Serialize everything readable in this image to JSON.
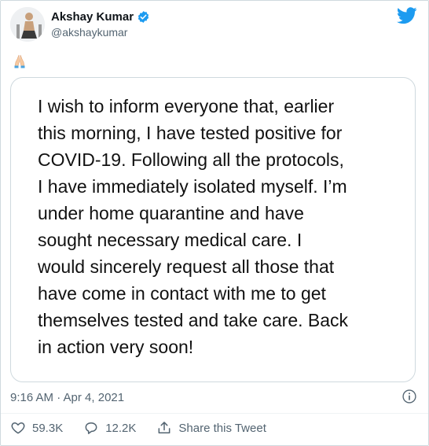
{
  "author": {
    "name": "Akshay Kumar",
    "handle": "@akshaykumar"
  },
  "tweet": {
    "emoji": "🙏",
    "image_text": "I wish to inform everyone that, earlier\nthis morning, I have tested positive for\nCOVID-19. Following all the protocols,\nI have immediately isolated myself. I’m\nunder home quarantine and have\nsought necessary medical care. I\nwould sincerely request all those that\nhave come in contact with me to get\nthemselves tested and take care. Back\nin action very soon!",
    "timestamp": "9:16 AM · Apr 4, 2021"
  },
  "stats": {
    "likes": "59.3K",
    "replies": "12.2K",
    "share_label": "Share this Tweet"
  },
  "colors": {
    "brand_blue": "#1d9bf0",
    "secondary_text": "#536471"
  },
  "icons": [
    "verified-badge-icon",
    "twitter-bird-icon",
    "info-icon",
    "heart-icon",
    "reply-icon",
    "share-icon"
  ]
}
